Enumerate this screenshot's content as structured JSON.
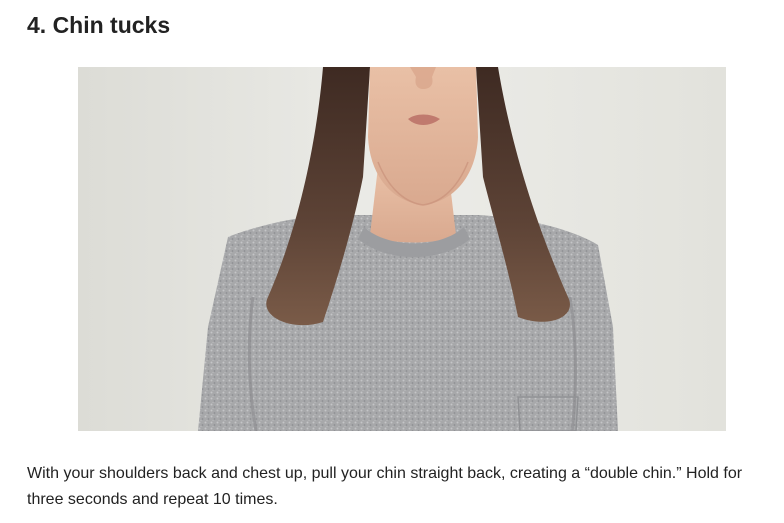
{
  "article": {
    "section_heading": "4. Chin tucks",
    "instruction_text": "With your shoulders back and chest up, pull your chin straight back, creating a “double chin.” Hold for three seconds and repeat 10 times."
  },
  "figure": {
    "subject": "person-demonstrating-chin-tuck",
    "colors": {
      "background": "#e7e8e3",
      "sweater": "#a9aaac",
      "hair": "#5a4034",
      "skin": "#e2b59c"
    }
  }
}
